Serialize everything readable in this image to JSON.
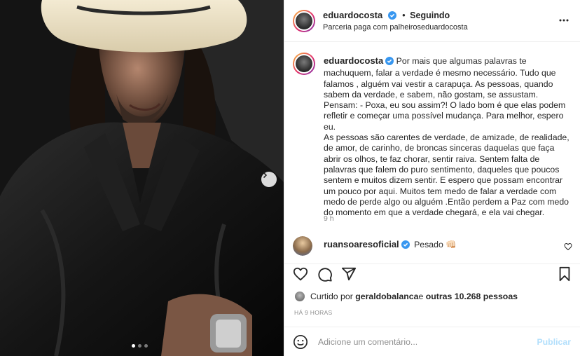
{
  "post": {
    "username": "eduardocosta",
    "follow_separator": "•",
    "follow_state": "Seguindo",
    "partnership_prefix": "Parceria paga com ",
    "partner": "palheiroseduardocosta",
    "caption_username": "eduardocosta",
    "caption": "Por mais que algumas palavras te machuquem, falar a verdade é mesmo necessário. Tudo que falamos , alguém vai vestir a carapuça. As pessoas, quando sabem da verdade, e sabem, não gostam, se assustam. Pensam: - Poxa, eu sou assim?! O lado bom é que elas podem refletir e começar uma possível mudança. Para melhor, espero eu.\nAs pessoas são carentes de verdade, de amizade, de realidade, de amor, de carinho, de broncas sinceras daquelas que faça abrir os olhos, te faz chorar, sentir raiva. Sentem falta de palavras que falem do puro sentimento, daqueles que poucos sentem e muitos dizem sentir. E espero que possam encontrar um pouco por aqui. Muitos tem medo de falar a verdade com medo de perde algo ou alguém .Então perdem a Paz com medo do momento em que a verdade chegará, e ela vai chegar.",
    "caption_time": "9 h"
  },
  "comment": {
    "username": "ruansoaresoficial",
    "text": "Pesado ",
    "emoji": "👊🏻"
  },
  "likes": {
    "prefix": "Curtido por ",
    "user": "geraldobalanca",
    "middle": " e ",
    "others": "outras 10.268 pessoas"
  },
  "timestamp": "HÁ 9 HORAS",
  "add_comment": {
    "placeholder": "Adicione um comentário...",
    "publish_label": "Publicar"
  },
  "colors": {
    "verified": "#3897f0",
    "publish_disabled": "#b2dffc",
    "muted": "#8e8e8e"
  },
  "icons": [
    "chevron-right-icon",
    "more-icon",
    "verified-icon",
    "heart-icon",
    "comment-icon",
    "share-icon",
    "bookmark-icon",
    "emoji-icon"
  ]
}
